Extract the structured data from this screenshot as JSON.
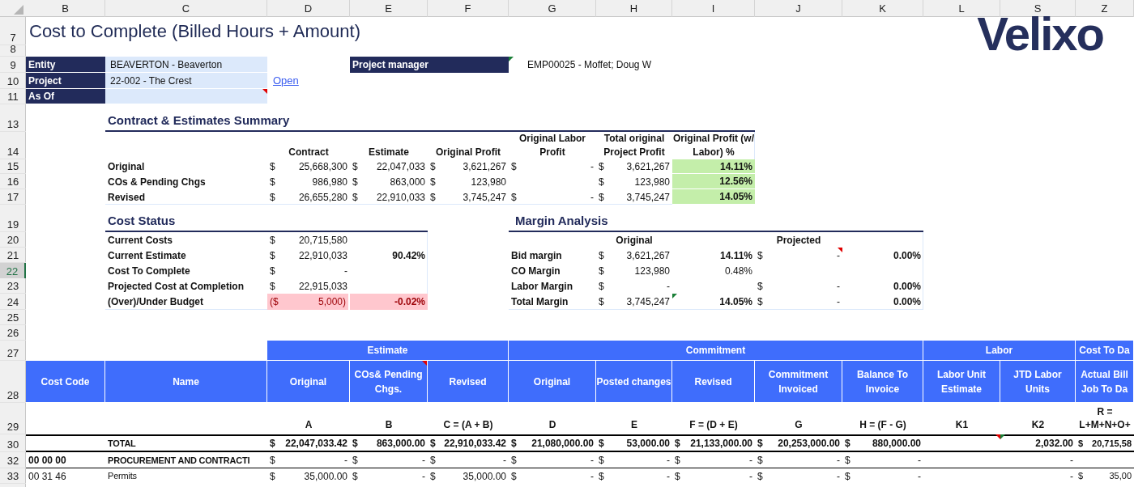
{
  "column_headers": [
    "B",
    "C",
    "D",
    "E",
    "F",
    "G",
    "H",
    "I",
    "J",
    "K",
    "L",
    "S",
    "Z"
  ],
  "row_headers": [
    {
      "label": "7",
      "selected": false
    },
    {
      "label": "8",
      "selected": false
    },
    {
      "label": "9",
      "selected": false
    },
    {
      "label": "10",
      "selected": false
    },
    {
      "label": "11",
      "selected": false
    },
    {
      "label": "13",
      "selected": false
    },
    {
      "label": "14",
      "selected": false
    },
    {
      "label": "15",
      "selected": false
    },
    {
      "label": "16",
      "selected": false
    },
    {
      "label": "17",
      "selected": false
    },
    {
      "label": "19",
      "selected": false
    },
    {
      "label": "20",
      "selected": false
    },
    {
      "label": "21",
      "selected": false
    },
    {
      "label": "22",
      "selected": true
    },
    {
      "label": "23",
      "selected": false
    },
    {
      "label": "24",
      "selected": false
    },
    {
      "label": "25",
      "selected": false
    },
    {
      "label": "26",
      "selected": false
    },
    {
      "label": "27",
      "selected": false
    },
    {
      "label": "28",
      "selected": false
    },
    {
      "label": "29",
      "selected": false
    },
    {
      "label": "30",
      "selected": false
    },
    {
      "label": "32",
      "selected": false
    },
    {
      "label": "33",
      "selected": false
    }
  ],
  "title": "Cost to Complete (Billed Hours + Amount)",
  "logo": "Velixo",
  "fields": [
    {
      "label": "Entity",
      "value": "BEAVERTON - Beaverton"
    },
    {
      "label": "Project",
      "value": "22-002 - The Crest",
      "link": "Open"
    },
    {
      "label": "As Of",
      "comment": true
    }
  ],
  "project_manager": {
    "label": "Project manager",
    "value": "EMP00025 - Moffet; Doug W",
    "error": true
  },
  "summary": {
    "title": "Contract & Estimates Summary",
    "columns": [
      "Contract",
      "Estimate",
      "Original Profit",
      "Original Labor Profit",
      "Total original Project Profit",
      "Original Profit (w/ Labor) %"
    ],
    "rows": [
      {
        "label": "Original",
        "cells": [
          {
            "cur": "$",
            "amt": "25,668,300"
          },
          {
            "cur": "$",
            "amt": "22,047,033"
          },
          {
            "cur": "$",
            "amt": "3,621,267"
          },
          {
            "cur": "$",
            "amt": "-"
          },
          {
            "cur": "$",
            "amt": "3,621,267"
          }
        ],
        "percent": "14.11%"
      },
      {
        "label": "COs & Pending Chgs",
        "cells": [
          {
            "cur": "$",
            "amt": "986,980"
          },
          {
            "cur": "$",
            "amt": "863,000"
          },
          {
            "cur": "$",
            "amt": "123,980"
          },
          null,
          {
            "cur": "$",
            "amt": "123,980"
          }
        ],
        "percent": "12.56%"
      },
      {
        "label": "Revised",
        "cells": [
          {
            "cur": "$",
            "amt": "26,655,280"
          },
          {
            "cur": "$",
            "amt": "22,910,033"
          },
          {
            "cur": "$",
            "amt": "3,745,247"
          },
          {
            "cur": "$",
            "amt": "-"
          },
          {
            "cur": "$",
            "amt": "3,745,247"
          }
        ],
        "percent": "14.05%"
      }
    ]
  },
  "cost_status": {
    "title": "Cost Status",
    "rows": [
      {
        "label": "Current Costs",
        "kind": "normal",
        "amount": {
          "cur": "$",
          "amt": "20,715,580"
        }
      },
      {
        "label": "Current Estimate",
        "kind": "normal",
        "amount": {
          "cur": "$",
          "amt": "22,910,033"
        },
        "percent": "90.42%"
      },
      {
        "label": "Cost To Complete",
        "kind": "normal",
        "amount": {
          "cur": "$",
          "amt": "-"
        }
      },
      {
        "label": "Projected Cost at Completion",
        "kind": "normal",
        "amount": {
          "cur": "$",
          "amt": "22,915,033"
        }
      },
      {
        "label": "(Over)/Under Budget",
        "kind": "negative",
        "amount": {
          "cur": "($",
          "amt": "5,000)"
        },
        "percent": "-0.02%"
      }
    ]
  },
  "margin_analysis": {
    "title": "Margin Analysis",
    "headers": [
      "Original",
      "Projected"
    ],
    "rows": [
      {
        "label": "Bid margin",
        "original": {
          "cur": "$",
          "amt": "3,621,267"
        },
        "original_percent": {
          "text": "14.11%",
          "bold": true
        },
        "projected": {
          "cur": "$",
          "amt": "-",
          "comment": true
        },
        "projected_percent": {
          "text": "0.00%",
          "bold": true
        }
      },
      {
        "label": "CO Margin",
        "original": {
          "cur": "$",
          "amt": "123,980"
        },
        "original_percent": {
          "text": "0.48%",
          "bold": false
        }
      },
      {
        "label": "Labor Margin",
        "original": {
          "cur": "$",
          "amt": "-"
        },
        "projected": {
          "cur": "$",
          "amt": "-"
        },
        "projected_percent": {
          "text": "0.00%",
          "bold": true
        }
      },
      {
        "label": "Total Margin",
        "original": {
          "cur": "$",
          "amt": "3,745,247"
        },
        "original_percent": {
          "text": "14.05%",
          "bold": true,
          "error": true
        },
        "projected": {
          "cur": "$",
          "amt": "-"
        },
        "projected_percent": {
          "text": "0.00%",
          "bold": true
        }
      }
    ]
  },
  "cost_table": {
    "leading_columns": [
      "Cost Code",
      "Name"
    ],
    "groups": [
      {
        "label": "Estimate",
        "columns": [
          {
            "label": "Original",
            "formula": "A"
          },
          {
            "label": "COs& Pending Chgs.",
            "formula": "B",
            "comment": true
          },
          {
            "label": "Revised",
            "formula": "C = (A + B)"
          }
        ]
      },
      {
        "label": "Commitment",
        "columns": [
          {
            "label": "Original",
            "formula": "D"
          },
          {
            "label": "Posted changes",
            "formula": "E"
          },
          {
            "label": "Revised",
            "formula": "F = (D + E)"
          },
          {
            "label": "Commitment Invoiced",
            "formula": "G"
          },
          {
            "label": "Balance To Invoice",
            "formula": "H = (F - G)"
          }
        ]
      },
      {
        "label": "Labor",
        "columns": [
          {
            "label": "Labor Unit Estimate",
            "formula": "K1"
          },
          {
            "label": "JTD Labor Units",
            "formula": "K2"
          }
        ]
      },
      {
        "label": "Cost To Da",
        "columns": [
          {
            "label": "Actual Bill Job To Da",
            "formula": "R = L+M+N+O+"
          }
        ]
      }
    ],
    "rows": [
      {
        "kind": "total",
        "name": "TOTAL",
        "cells": [
          {
            "cur": "$",
            "amt": "22,047,033.42"
          },
          {
            "cur": "$",
            "amt": "863,000.00"
          },
          {
            "cur": "$",
            "amt": "22,910,033.42"
          },
          {
            "cur": "$",
            "amt": "21,080,000.00"
          },
          {
            "cur": "$",
            "amt": "53,000.00"
          },
          {
            "cur": "$",
            "amt": "21,133,000.00"
          },
          {
            "cur": "$",
            "amt": "20,253,000.00"
          },
          {
            "cur": "$",
            "amt": "880,000.00"
          },
          {
            "comment": true
          },
          {
            "amt": "2,032.00",
            "error": true
          },
          {
            "cur": "$",
            "amt": "20,715,58"
          }
        ]
      },
      {
        "kind": "section",
        "code": "00 00 00",
        "name": "PROCUREMENT AND CONTRACTI",
        "cells": [
          {
            "cur": "$",
            "amt": "-"
          },
          {
            "cur": "$",
            "amt": "-"
          },
          {
            "cur": "$",
            "amt": "-"
          },
          {
            "cur": "$",
            "amt": "-"
          },
          {
            "cur": "$",
            "amt": "-"
          },
          {
            "cur": "$",
            "amt": "-"
          },
          {
            "cur": "$",
            "amt": "-"
          },
          {
            "cur": "$",
            "amt": "-"
          },
          null,
          {
            "amt": "-"
          },
          null
        ]
      },
      {
        "kind": "item",
        "code": "00 31 46",
        "name": "Permits",
        "cells": [
          {
            "cur": "$",
            "amt": "35,000.00"
          },
          {
            "cur": "$",
            "amt": "-"
          },
          {
            "cur": "$",
            "amt": "35,000.00"
          },
          {
            "cur": "$",
            "amt": "-"
          },
          {
            "cur": "$",
            "amt": "-"
          },
          {
            "cur": "$",
            "amt": "-"
          },
          {
            "cur": "$",
            "amt": "-"
          },
          {
            "cur": "$",
            "amt": "-"
          },
          null,
          {
            "amt": "-"
          },
          {
            "cur": "$",
            "amt": "35,00"
          }
        ]
      }
    ]
  }
}
